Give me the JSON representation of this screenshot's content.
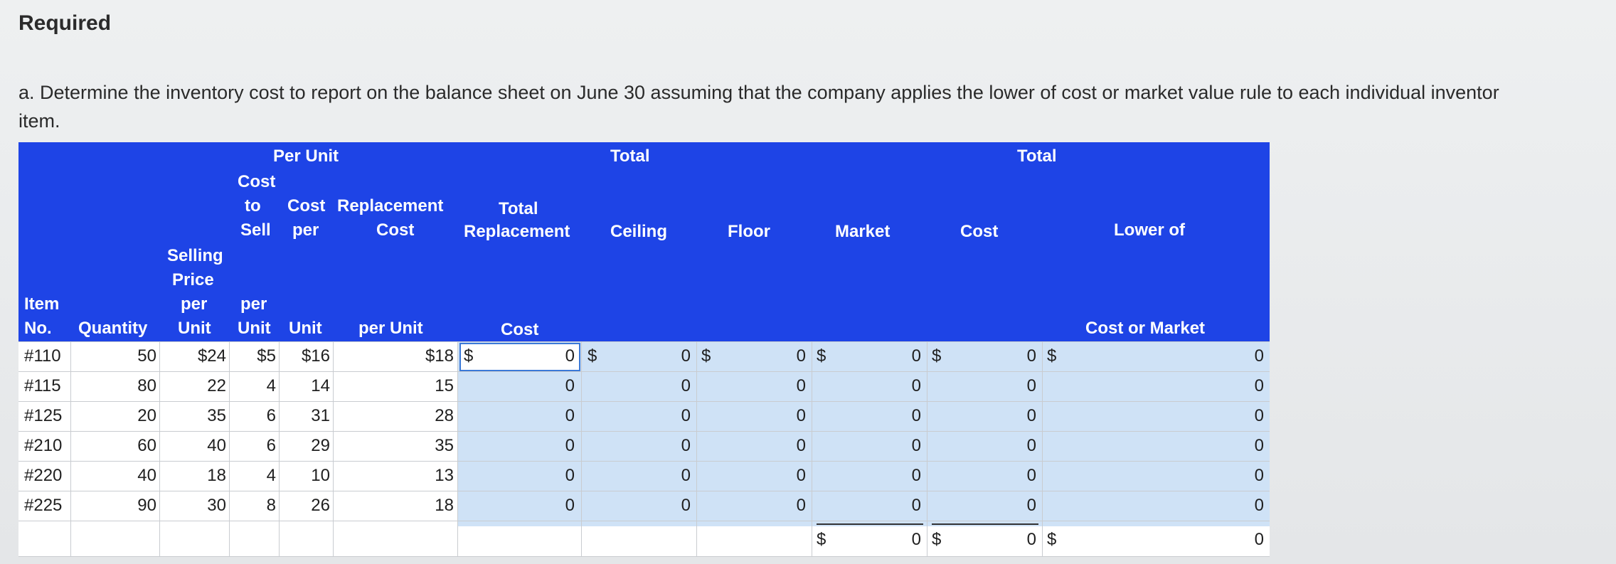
{
  "heading": "Required",
  "question_line1": "a. Determine the inventory cost to report on the balance sheet on June 30 assuming that the company applies the lower of cost or market value rule to each individual inventor",
  "question_line2": "item.",
  "headers": {
    "per_unit": "Per Unit",
    "total_1": "Total",
    "total_2": "Total",
    "item": "Item",
    "no": "No.",
    "quantity": "Quantity",
    "selling": "Selling",
    "price": "Price",
    "per": "per",
    "unit": "Unit",
    "cost": "Cost",
    "to": "to",
    "sell": "Sell",
    "cost2": "Cost",
    "per2": "per",
    "replacement": "Replacement",
    "cost3": "Cost",
    "per_unit_rc": "per Unit",
    "total_h": "Total",
    "replacement2": "Replacement",
    "cost_tr": "Cost",
    "ceiling": "Ceiling",
    "floor": "Floor",
    "market": "Market",
    "cost_total": "Cost",
    "lower_of": "Lower of",
    "cost_or_market": "Cost or Market"
  },
  "rows": [
    {
      "item": "#110",
      "qty": "50",
      "price": "$24",
      "sell": "$5",
      "cpu": "$16",
      "rc": "$18",
      "tr": "0",
      "ceiling": "0",
      "floor": "0",
      "market": "0",
      "cost": "0",
      "lcm": "0"
    },
    {
      "item": "#115",
      "qty": "80",
      "price": "22",
      "sell": "4",
      "cpu": "14",
      "rc": "15",
      "tr": "0",
      "ceiling": "0",
      "floor": "0",
      "market": "0",
      "cost": "0",
      "lcm": "0"
    },
    {
      "item": "#125",
      "qty": "20",
      "price": "35",
      "sell": "6",
      "cpu": "31",
      "rc": "28",
      "tr": "0",
      "ceiling": "0",
      "floor": "0",
      "market": "0",
      "cost": "0",
      "lcm": "0"
    },
    {
      "item": "#210",
      "qty": "60",
      "price": "40",
      "sell": "6",
      "cpu": "29",
      "rc": "35",
      "tr": "0",
      "ceiling": "0",
      "floor": "0",
      "market": "0",
      "cost": "0",
      "lcm": "0"
    },
    {
      "item": "#220",
      "qty": "40",
      "price": "18",
      "sell": "4",
      "cpu": "10",
      "rc": "13",
      "tr": "0",
      "ceiling": "0",
      "floor": "0",
      "market": "0",
      "cost": "0",
      "lcm": "0"
    },
    {
      "item": "#225",
      "qty": "90",
      "price": "30",
      "sell": "8",
      "cpu": "26",
      "rc": "18",
      "tr": "0",
      "ceiling": "0",
      "floor": "0",
      "market": "0",
      "cost": "0",
      "lcm": "0"
    }
  ],
  "totals": {
    "market": "0",
    "cost": "0",
    "lcm": "0"
  },
  "currency_symbol": "$"
}
